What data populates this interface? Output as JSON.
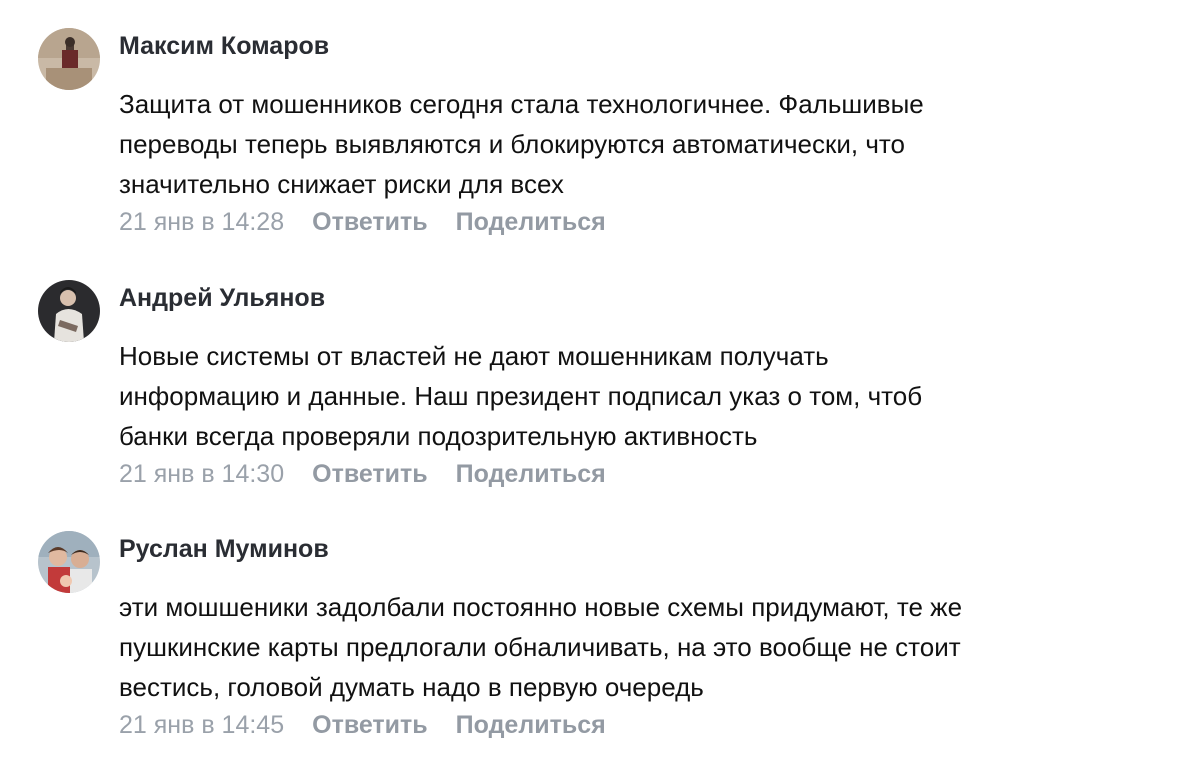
{
  "comments": [
    {
      "author": "Максим Комаров",
      "avatar_icon": "user-avatar-photo",
      "lines": [
        "Защита от мошенников сегодня стала технологичнее. Фальшивые",
        "переводы теперь выявляются и блокируются автоматически, что",
        "значительно снижает риски для всех"
      ],
      "date": "21 янв в 14:28",
      "reply_label": "Ответить",
      "share_label": "Поделиться"
    },
    {
      "author": "Андрей Ульянов",
      "avatar_icon": "user-avatar-photo",
      "lines": [
        "Новые системы от властей не дают мошенникам получать",
        "информацию и данные. Наш президент подписал указ о том, чтоб",
        "банки всегда проверяли подозрительную активность"
      ],
      "date": "21 янв в 14:30",
      "reply_label": "Ответить",
      "share_label": "Поделиться"
    },
    {
      "author": "Руслан Муминов",
      "avatar_icon": "user-avatar-photo",
      "lines": [
        "эти мошшеники задолбали постоянно новые схемы придумают, те же",
        "пушкинские карты предлогали обналичивать, на это вообще не стоит",
        "вестись, головой думать надо в первую очередь"
      ],
      "date": "21 янв в 14:45",
      "reply_label": "Ответить",
      "share_label": "Поделиться"
    }
  ],
  "colors": {
    "author": "#2a2d33",
    "text": "#111111",
    "date": "#9aa1aa",
    "action": "#939aa3",
    "background": "#ffffff"
  }
}
